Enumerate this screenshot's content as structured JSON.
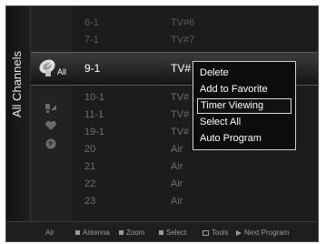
{
  "sidebar": {
    "title": "All Channels"
  },
  "mode": {
    "selected_label": "All"
  },
  "channels": [
    {
      "number": "6-1",
      "name": "TV#6"
    },
    {
      "number": "7-1",
      "name": "TV#7"
    },
    {
      "number": "9-1",
      "name": "TV#"
    },
    {
      "number": "10-1",
      "name": "TV#"
    },
    {
      "number": "11-1",
      "name": "TV#"
    },
    {
      "number": "19-1",
      "name": "TV#"
    },
    {
      "number": "20",
      "name": "Air"
    },
    {
      "number": "21",
      "name": "Air"
    },
    {
      "number": "22",
      "name": "Air"
    },
    {
      "number": "23",
      "name": "Air"
    }
  ],
  "popup_menu": {
    "items": [
      "Delete",
      "Add to Favorite",
      "Timer Viewing",
      "Select All",
      "Auto Program"
    ],
    "focused_index": 2
  },
  "footer": {
    "source": "Air",
    "antenna": "Antenna",
    "zoom": "Zoom",
    "select": "Select",
    "tools": "Tools",
    "next_program": "Next Program"
  },
  "colors": {
    "background": "#1c1c1c",
    "text_primary": "#ffffff",
    "text_dim": "#5a5a5a",
    "popup_border": "#cfcfcf"
  }
}
